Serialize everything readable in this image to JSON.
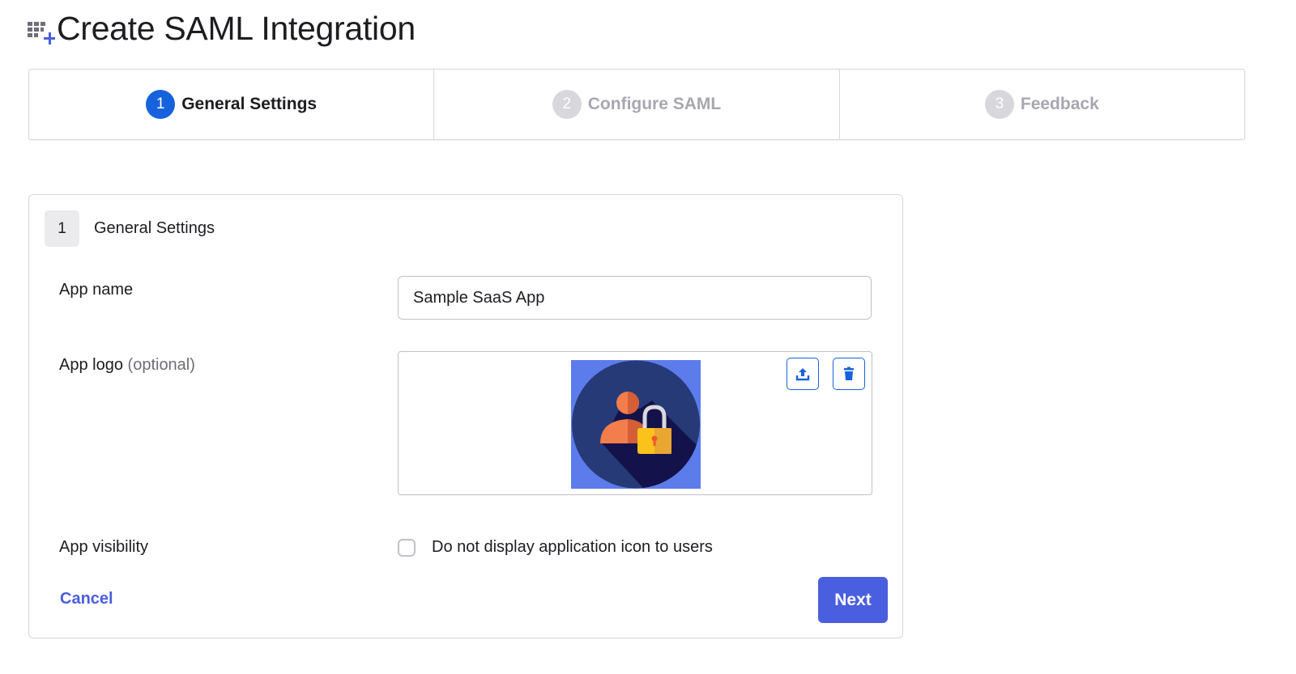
{
  "header": {
    "title": "Create SAML Integration",
    "icon": "add-app-grid-icon"
  },
  "stepper": {
    "steps": [
      {
        "number": "1",
        "label": "General Settings",
        "state": "active"
      },
      {
        "number": "2",
        "label": "Configure SAML",
        "state": "inactive"
      },
      {
        "number": "3",
        "label": "Feedback",
        "state": "inactive"
      }
    ]
  },
  "form": {
    "section_number": "1",
    "section_title": "General Settings",
    "app_name": {
      "label": "App name",
      "value": "Sample SaaS App"
    },
    "app_logo": {
      "label": "App logo",
      "optional": "(optional)",
      "logo_icon": "user-lock-icon",
      "upload_icon": "upload-icon",
      "delete_icon": "trash-icon"
    },
    "app_visibility": {
      "label": "App visibility",
      "checkbox_label": "Do not display application icon to users",
      "checked": false
    },
    "cancel_label": "Cancel",
    "next_label": "Next"
  },
  "colors": {
    "accent": "#4a5ee0",
    "step_active": "#1662dd",
    "step_inactive": "#d7d7dc",
    "border": "#d7d7dc"
  }
}
